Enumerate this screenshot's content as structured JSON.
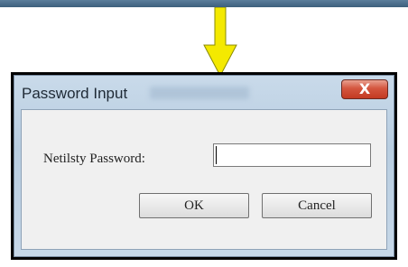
{
  "dialog": {
    "title": "Password Input",
    "close_label": "X",
    "field_label": "Netilsty Password:",
    "password_value": "",
    "ok_label": "OK",
    "cancel_label": "Cancel"
  },
  "colors": {
    "arrow": "#f4e900",
    "top_bar": "#4a6c89",
    "close_button": "#d04a33"
  }
}
